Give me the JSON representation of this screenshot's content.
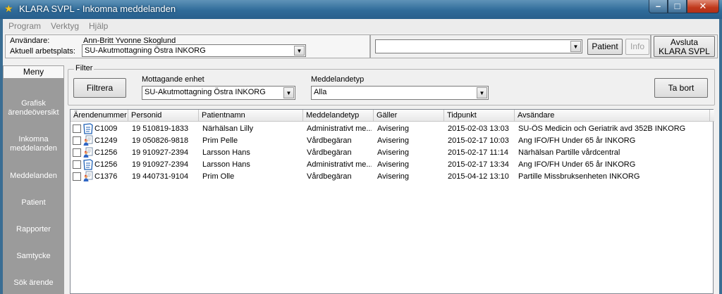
{
  "window": {
    "title": "KLARA SVPL - Inkomna meddelanden"
  },
  "menu": [
    "Program",
    "Verktyg",
    "Hjälp"
  ],
  "user": {
    "user_label": "Användare:",
    "user_name": "Ann-Britt Yvonne Skoglund",
    "workplace_label": "Aktuell arbetsplats:",
    "workplace_value": "SU-Akutmottagning Östra INKORG"
  },
  "patient_search": {
    "value": "",
    "patient_button": "Patient",
    "info_button": "Info"
  },
  "exit_button": {
    "line1": "Avsluta",
    "line2": "KLARA SVPL"
  },
  "sidebar": {
    "tab": "Meny",
    "items": [
      {
        "line1": "Grafisk",
        "line2": "ärendeöversikt"
      },
      {
        "line1": "Inkomna",
        "line2": "meddelanden"
      },
      {
        "line1": "Meddelanden",
        "line2": ""
      },
      {
        "line1": "Patient",
        "line2": ""
      },
      {
        "line1": "Rapporter",
        "line2": ""
      },
      {
        "line1": "Samtycke",
        "line2": ""
      },
      {
        "line1": "Sök ärende",
        "line2": ""
      }
    ]
  },
  "filter": {
    "legend": "Filter",
    "filter_button": "Filtrera",
    "unit_label": "Mottagande enhet",
    "unit_value": "SU-Akutmottagning Östra INKORG",
    "type_label": "Meddelandetyp",
    "type_value": "Alla",
    "delete_button": "Ta bort"
  },
  "table": {
    "columns": [
      "Ärendenummer",
      "Personid",
      "Patientnamn",
      "Meddelandetyp",
      "Gäller",
      "Tidpunkt",
      "Avsändare"
    ],
    "rows": [
      {
        "icon": "document-icon",
        "case": "C1009",
        "personid": "19 510819-1833",
        "name": "Närhälsan Lilly",
        "type": "Administrativt me...",
        "applies": "Avisering",
        "time": "2015-02-03 13:03",
        "sender": "SU-ÖS Medicin och Geriatrik avd 352B INKORG"
      },
      {
        "icon": "care-request-icon",
        "case": "C1249",
        "personid": "19 050826-9818",
        "name": "Prim Pelle",
        "type": "Vårdbegäran",
        "applies": "Avisering",
        "time": "2015-02-17 10:03",
        "sender": "Ang IFO/FH Under 65 år INKORG"
      },
      {
        "icon": "care-request-icon",
        "case": "C1256",
        "personid": "19 910927-2394",
        "name": "Larsson Hans",
        "type": "Vårdbegäran",
        "applies": "Avisering",
        "time": "2015-02-17 11:14",
        "sender": "Närhälsan Partille vårdcentral"
      },
      {
        "icon": "document-icon",
        "case": "C1256",
        "personid": "19 910927-2394",
        "name": "Larsson Hans",
        "type": "Administrativt me...",
        "applies": "Avisering",
        "time": "2015-02-17 13:34",
        "sender": "Ang IFO/FH Under 65 år INKORG"
      },
      {
        "icon": "care-request-icon",
        "case": "C1376",
        "personid": "19 440731-9104",
        "name": "Prim Olle",
        "type": "Vårdbegäran",
        "applies": "Avisering",
        "time": "2015-04-12 13:10",
        "sender": "Partille Missbruksenheten INKORG"
      }
    ]
  }
}
